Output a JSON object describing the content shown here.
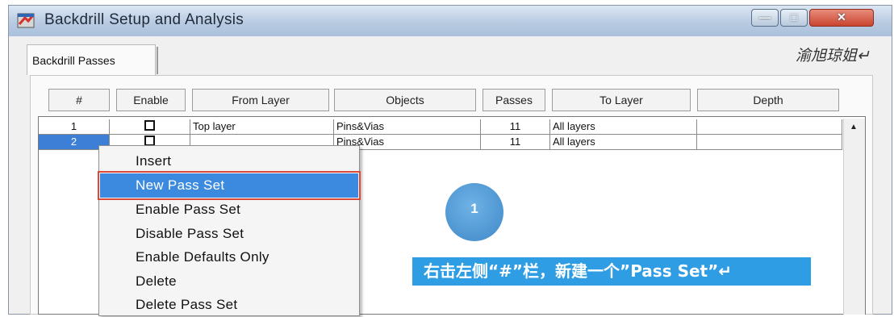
{
  "window": {
    "title": "Backdrill Setup and Analysis",
    "controls": {
      "minimize": "—",
      "maximize": "□",
      "close": "✕"
    }
  },
  "tab": {
    "label": "Backdrill Passes"
  },
  "watermark": "渝旭琼姐↵",
  "table": {
    "columns": [
      "#",
      "Enable",
      "From Layer",
      "Objects",
      "Passes",
      "To Layer",
      "Depth"
    ],
    "rows": [
      {
        "num": "1",
        "enable": "☐",
        "from_layer": "Top layer",
        "objects": "Pins&Vias",
        "passes": "11",
        "to_layer": "All layers",
        "depth": ""
      },
      {
        "num": "2",
        "enable": "☐",
        "from_layer": "",
        "objects": "Pins&Vias",
        "passes": "11",
        "to_layer": "All layers",
        "depth": ""
      }
    ],
    "scroll_up": "▲"
  },
  "context_menu": {
    "items": [
      "Insert",
      "New Pass Set",
      "Enable Pass Set",
      "Disable Pass Set",
      "Enable Defaults Only",
      "Delete",
      "Delete Pass Set"
    ],
    "highlighted_index": 1
  },
  "annotation": {
    "step_number": "1",
    "callout_text": "右击左侧“#”栏，新建一个”Pass Set”↵"
  },
  "colors": {
    "selection": "#3d7fd6",
    "highlight_border": "#d94a3a",
    "callout": "#2e9de4"
  }
}
